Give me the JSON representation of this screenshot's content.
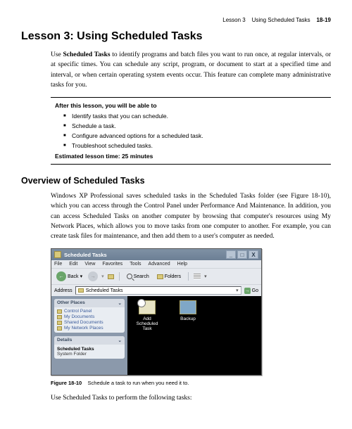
{
  "header": {
    "lesson_label": "Lesson 3",
    "section_title": "Using Scheduled Tasks",
    "page_number": "18-19"
  },
  "lesson_title": "Lesson 3:  Using Scheduled Tasks",
  "intro": {
    "prefix": "Use ",
    "bold": "Scheduled Tasks",
    "rest": " to identify programs and batch files you want to run once, at regular intervals, or at specific times. You can schedule any script, program, or document to start at a specified time and interval, or when certain operating system events occur. This feature can complete many administrative tasks for you."
  },
  "objectives": {
    "heading": "After this lesson, you will be able to",
    "items": [
      "Identify tasks that you can schedule.",
      "Schedule a task.",
      "Configure advanced options for a scheduled task.",
      "Troubleshoot scheduled tasks."
    ],
    "estimated": "Estimated lesson time:  25 minutes"
  },
  "overview_title": "Overview of Scheduled Tasks",
  "overview_para": "Windows XP Professional saves scheduled tasks in the Scheduled Tasks folder (see Figure 18-10), which you can access through the Control Panel under Performance And Maintenance. In addition, you can access Scheduled Tasks on another computer by browsing that computer's resources using My Network Places, which allows you to move tasks from one computer to another. For example, you can create task files for maintenance, and then add them to a user's computer as needed.",
  "screenshot": {
    "titlebar": {
      "title": "Scheduled Tasks",
      "controls": {
        "minimize": "_",
        "maximize": "□",
        "close": "X"
      }
    },
    "menu": [
      "File",
      "Edit",
      "View",
      "Favorites",
      "Tools",
      "Advanced",
      "Help"
    ],
    "toolbar": {
      "back_label": "Back",
      "search_label": "Search",
      "folders_label": "Folders"
    },
    "address": {
      "label": "Address",
      "value": "Scheduled Tasks",
      "go": "Go"
    },
    "sidebar": {
      "other_places": {
        "title": "Other Places",
        "items": [
          "Control Panel",
          "My Documents",
          "Shared Documents",
          "My Network Places"
        ]
      },
      "details": {
        "title": "Details",
        "name": "Scheduled Tasks",
        "type": "System Folder"
      }
    },
    "content_icons": [
      {
        "label": "Add Scheduled Task"
      },
      {
        "label": "Backup"
      }
    ]
  },
  "figure": {
    "label": "Figure 18-10",
    "caption": "Schedule a task to run when you need it to."
  },
  "closing_line": "Use Scheduled Tasks to perform the following tasks:"
}
